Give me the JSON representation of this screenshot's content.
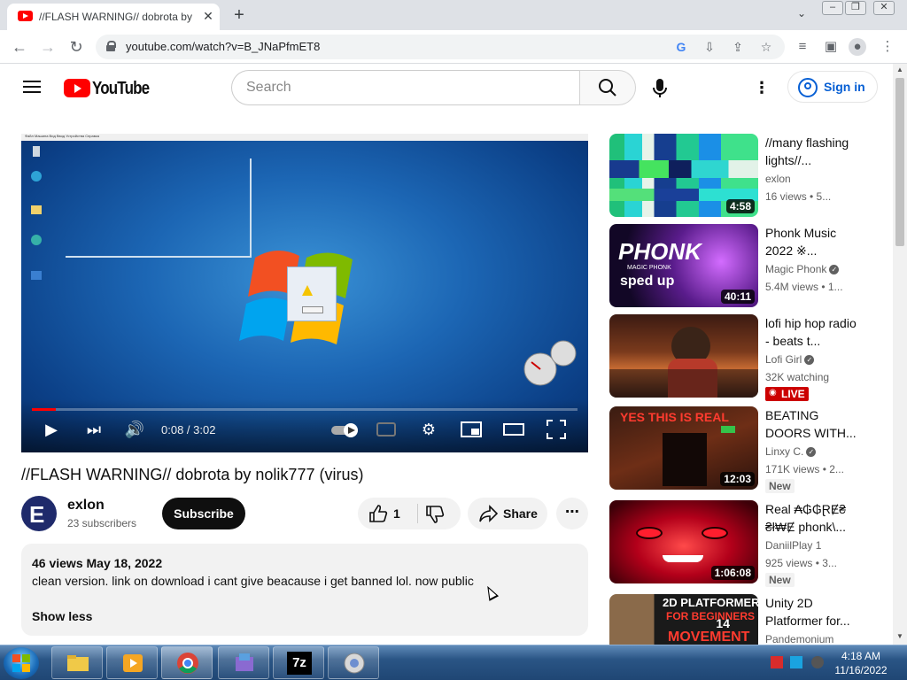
{
  "browser": {
    "tab_title": "//FLASH WARNING// dobrota by",
    "tab_close": "✕",
    "new_tab": "+",
    "url": "youtube.com/watch?v=B_JNaPfmET8"
  },
  "masthead": {
    "logo_text": "YouTube",
    "search_placeholder": "Search",
    "signin_label": "Sign in"
  },
  "player": {
    "time": "0:08 / 3:02",
    "progress_fraction": 0.044,
    "desktop_menu": "Файл   Машина   Вид   Ввод   Устройства   Справка"
  },
  "video": {
    "title": "//FLASH WARNING// dobrota by nolik777 (virus)",
    "channel": "exlon",
    "subscribers": "23 subscribers",
    "subscribe_label": "Subscribe",
    "likes": "1",
    "share_label": "Share",
    "meta": "46 views  May 18, 2022",
    "description": "clean version. link on download i cant give beacause i get banned lol. now public",
    "show_less": "Show less"
  },
  "recommendations": [
    {
      "title": "//many flashing lights//...",
      "channel": "exlon",
      "stats": "16 views  • 5...",
      "duration": "4:58",
      "verified": false,
      "badge": ""
    },
    {
      "title": "Phonk Music 2022 ※...",
      "channel": "Magic Phonk",
      "stats": "5.4M views  • 1...",
      "duration": "40:11",
      "verified": true,
      "badge": "",
      "thumb_text": "PHONK",
      "thumb_sub": "MAGIC PHONK",
      "thumb_sub2": "sped up"
    },
    {
      "title": "lofi hip hop radio - beats t...",
      "channel": "Lofi Girl",
      "stats": "32K watching",
      "duration": "",
      "verified": true,
      "badge": "LIVE"
    },
    {
      "title": "BEATING DOORS WITH...",
      "channel": "Linxy C.",
      "stats": "171K views  • 2...",
      "duration": "12:03",
      "verified": true,
      "badge": "New",
      "thumb_text": "YES THIS IS REAL"
    },
    {
      "title": "Real ₳₲₲ⱤɆ₴ ₴ł₩Ɇ phonk\\...",
      "channel": "DaniilPlay 1",
      "stats": "925 views  • 3...",
      "duration": "1:06:08",
      "verified": false,
      "badge": "New"
    },
    {
      "title": "Unity 2D Platformer for...",
      "channel": "Pandemonium",
      "stats": "",
      "duration": "14",
      "verified": false,
      "badge": "",
      "thumb_text": "2D PLATFORMER",
      "thumb_sub": "FOR BEGINNERS",
      "thumb_sub2": "MOVEMENT"
    }
  ],
  "taskbar": {
    "time": "4:18 AM",
    "date": "11/16/2022",
    "sevenzip_label": "7z"
  },
  "colors": {
    "youtube_red": "#ff0000",
    "link_blue": "#065fd4",
    "live_red": "#cc0000"
  }
}
